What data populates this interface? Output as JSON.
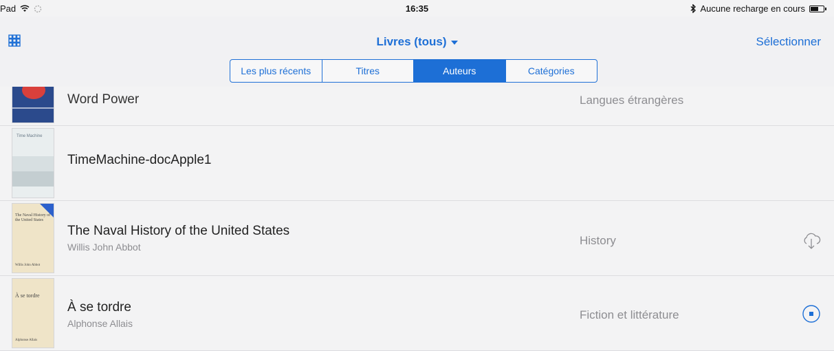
{
  "status": {
    "device": "Pad",
    "time": "16:35",
    "charging": "Aucune recharge en cours"
  },
  "nav": {
    "title": "Livres (tous)",
    "select": "Sélectionner"
  },
  "tabs": [
    {
      "label": "Les plus récents",
      "active": false
    },
    {
      "label": "Titres",
      "active": false
    },
    {
      "label": "Auteurs",
      "active": true
    },
    {
      "label": "Catégories",
      "active": false
    }
  ],
  "books": [
    {
      "title": "Word Power",
      "author": "",
      "category": "Langues étrangères",
      "action": ""
    },
    {
      "title": "TimeMachine-docApple1",
      "author": "",
      "category": "",
      "action": ""
    },
    {
      "title": "The Naval History of the United States",
      "author": "Willis John Abbot",
      "category": "History",
      "action": "cloud-download-icon"
    },
    {
      "title": "À se tordre",
      "author": "Alphonse Allais",
      "category": "Fiction et littérature",
      "action": "stop-download-icon"
    }
  ],
  "covers": {
    "timemachine": "Time Machine",
    "naval": "The Naval History of the United States",
    "naval_foot": "Willis John Abbot",
    "tordre": "À se tordre",
    "tordre_foot": "Alphonse Allais"
  },
  "colors": {
    "accent": "#1d6fd6",
    "background": "#f3f3f4"
  }
}
